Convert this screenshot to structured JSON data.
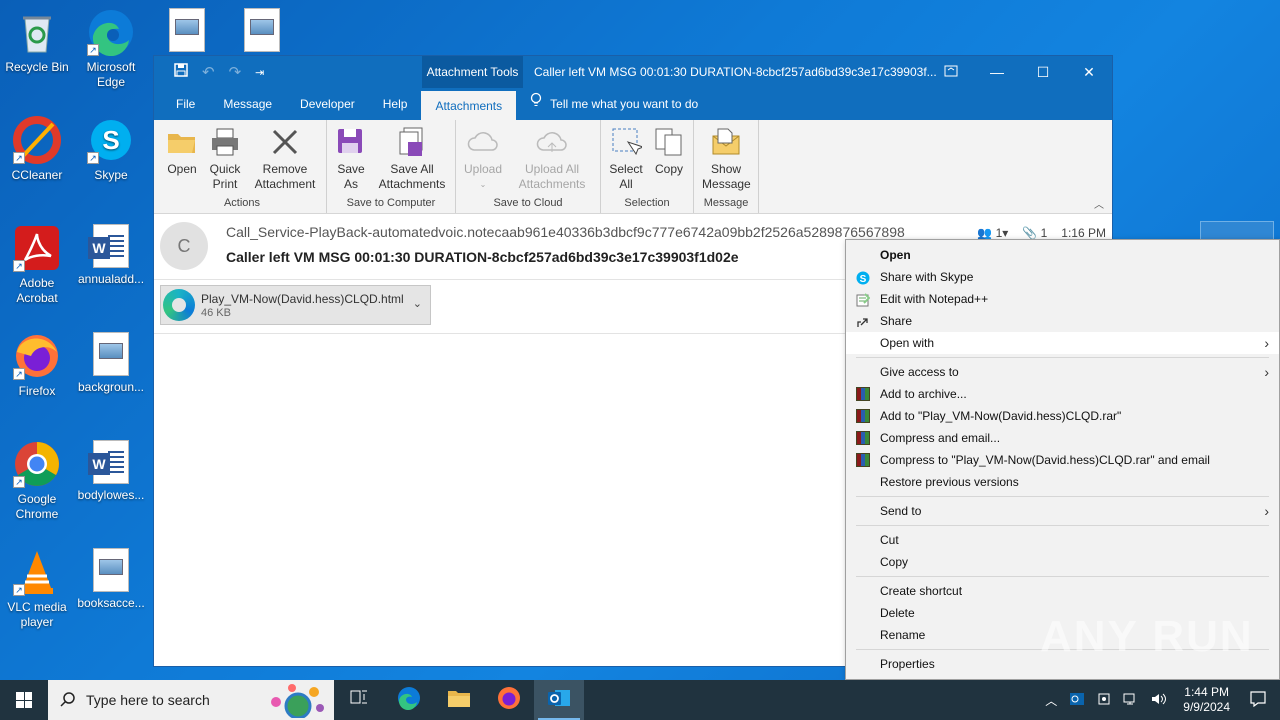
{
  "desktop": {
    "icons": [
      {
        "label": "Recycle Bin"
      },
      {
        "label": "Microsoft Edge"
      },
      {
        "label": "CCleaner"
      },
      {
        "label": "Skype"
      },
      {
        "label": "Adobe Acrobat"
      },
      {
        "label": "annualadd..."
      },
      {
        "label": "Firefox"
      },
      {
        "label": "backgroun..."
      },
      {
        "label": "Google Chrome"
      },
      {
        "label": "bodylowes..."
      },
      {
        "label": "VLC media player"
      },
      {
        "label": "booksacce..."
      }
    ]
  },
  "window": {
    "context_tab": "Attachment Tools",
    "title": "Caller left VM MSG 00:01:30 DURATION-8cbcf257ad6bd39c3e17c39903f...",
    "tabs": [
      "File",
      "Message",
      "Developer",
      "Help",
      "Attachments"
    ],
    "tell_me": "Tell me what you want to do"
  },
  "ribbon": {
    "groups": [
      {
        "label": "Actions",
        "buttons": [
          "Open",
          "Quick Print",
          "Remove Attachment"
        ]
      },
      {
        "label": "Save to Computer",
        "buttons": [
          "Save As",
          "Save All Attachments"
        ]
      },
      {
        "label": "Save to Cloud",
        "buttons": [
          "Upload",
          "Upload All Attachments"
        ]
      },
      {
        "label": "Selection",
        "buttons": [
          "Select All",
          "Copy"
        ]
      },
      {
        "label": "Message",
        "buttons": [
          "Show Message"
        ]
      }
    ]
  },
  "message": {
    "avatar_letter": "C",
    "sender": "Call_Service-PlayBack-automatedvoic.notecaab961e40336b3dbcf9c777e6742a09bb2f2526a5289876567898",
    "subject": "Caller left VM MSG 00:01:30 DURATION-8cbcf257ad6bd39c3e17c39903f1d02e",
    "people_count": "1",
    "attach_count": "1",
    "time": "1:16 PM",
    "attachment": {
      "name": "Play_VM-Now(David.hess)CLQD.html",
      "size": "46 KB"
    }
  },
  "context_menu": {
    "items": [
      "Open",
      "Share with Skype",
      "Edit with Notepad++",
      "Share",
      "Open with",
      "Give access to",
      "Add to archive...",
      "Add to \"Play_VM-Now(David.hess)CLQD.rar\"",
      "Compress and email...",
      "Compress to \"Play_VM-Now(David.hess)CLQD.rar\" and email",
      "Restore previous versions",
      "Send to",
      "Cut",
      "Copy",
      "Create shortcut",
      "Delete",
      "Rename",
      "Properties"
    ]
  },
  "watermark": "ANY RUN",
  "taskbar": {
    "search_placeholder": "Type here to search",
    "time": "1:44 PM",
    "date": "9/9/2024"
  }
}
